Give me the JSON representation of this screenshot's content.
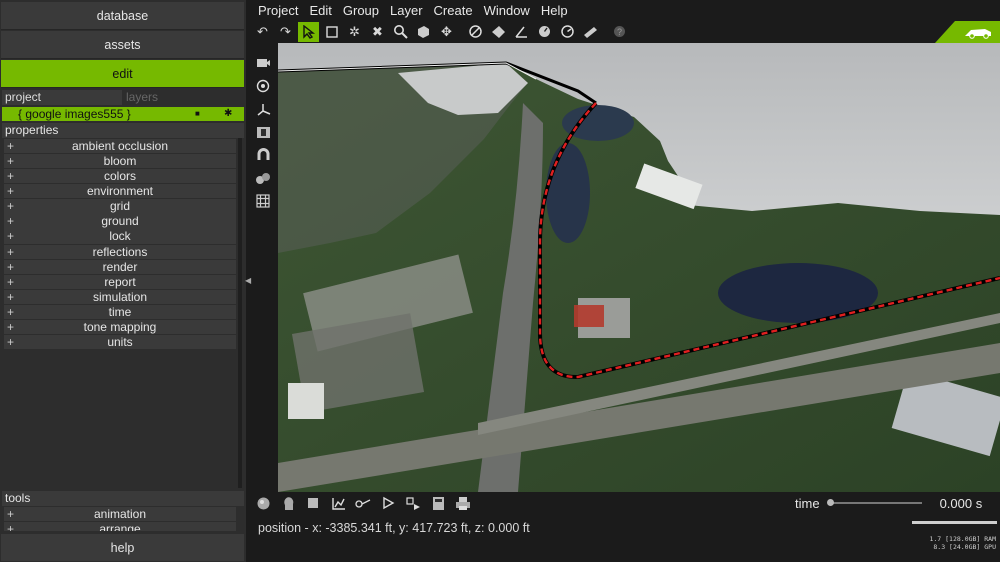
{
  "nav": {
    "database": "database",
    "assets": "assets",
    "edit": "edit",
    "help": "help"
  },
  "tabs": {
    "project": "project",
    "layers": "layers"
  },
  "layer_item": {
    "label": "{ google images555 }",
    "lock_icon": "lock-icon",
    "visibility_icon": "asterisk-icon"
  },
  "properties": {
    "header": "properties",
    "items": [
      "ambient occlusion",
      "bloom",
      "colors",
      "environment",
      "grid",
      "ground",
      "lock",
      "reflections",
      "render",
      "report",
      "simulation",
      "time",
      "tone mapping",
      "units"
    ]
  },
  "tools": {
    "header": "tools",
    "items": [
      "animation",
      "arrange"
    ]
  },
  "menu": [
    "Project",
    "Edit",
    "Group",
    "Layer",
    "Create",
    "Window",
    "Help"
  ],
  "toolbar_icons": [
    "undo-icon",
    "redo-icon",
    "select-icon",
    "rectangle-select-icon",
    "transform-icon",
    "delete-icon",
    "zoom-icon",
    "box-icon",
    "move-icon",
    "measure-icon",
    "surface-icon",
    "angle-icon",
    "clock-icon",
    "speedometer-icon",
    "ruler-icon",
    "help-icon"
  ],
  "time": {
    "label": "time",
    "value": "0.000 s",
    "position": 0.0
  },
  "status": {
    "position": "position - x: -3385.341 ft, y: 417.723 ft, z: 0.000 ft"
  },
  "memory": {
    "ram": "1.7 [128.0GB] RAM",
    "gpu": "8.3 [24.0GB] GPU"
  },
  "colors": {
    "accent": "#76b900",
    "route": "#e02020",
    "panel": "#2d2d2d",
    "button": "#3a3a3a"
  }
}
